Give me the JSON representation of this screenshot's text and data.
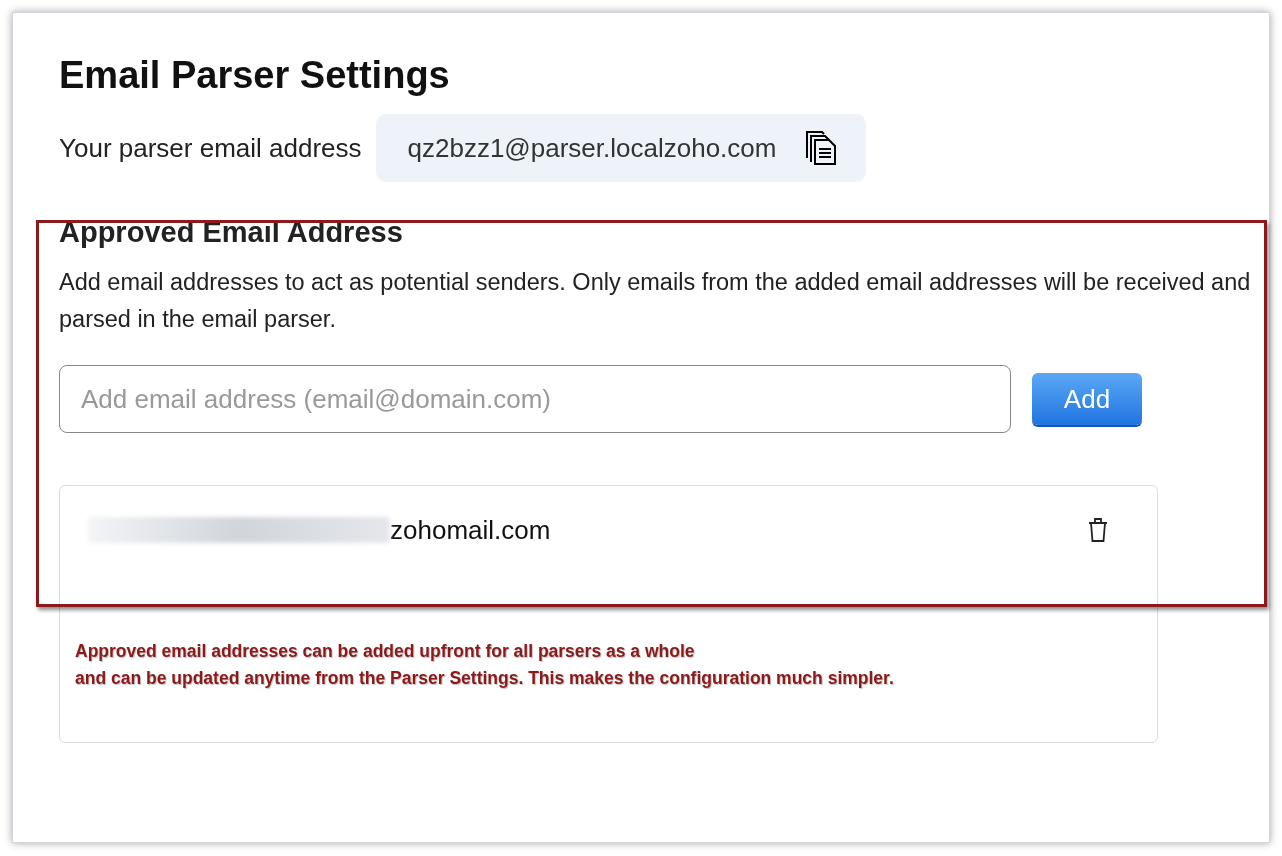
{
  "title": "Email Parser Settings",
  "parser_address": {
    "label": "Your parser email address",
    "value": "qz2bzz1@parser.localzoho.com"
  },
  "approved": {
    "heading": "Approved Email Address",
    "description": "Add email addresses to act as potential senders. Only emails from the added email addresses will be received and parsed in the email parser.",
    "input": {
      "placeholder": "Add email address (email@domain.com)"
    },
    "add_button": "Add",
    "emails": [
      {
        "text": "zohomail.com",
        "redacted": true
      }
    ]
  },
  "annotation": [
    "Approved email addresses can be added upfront for all parsers as a whole",
    "and can be updated anytime from the Parser Settings. This makes the configuration much simpler."
  ]
}
